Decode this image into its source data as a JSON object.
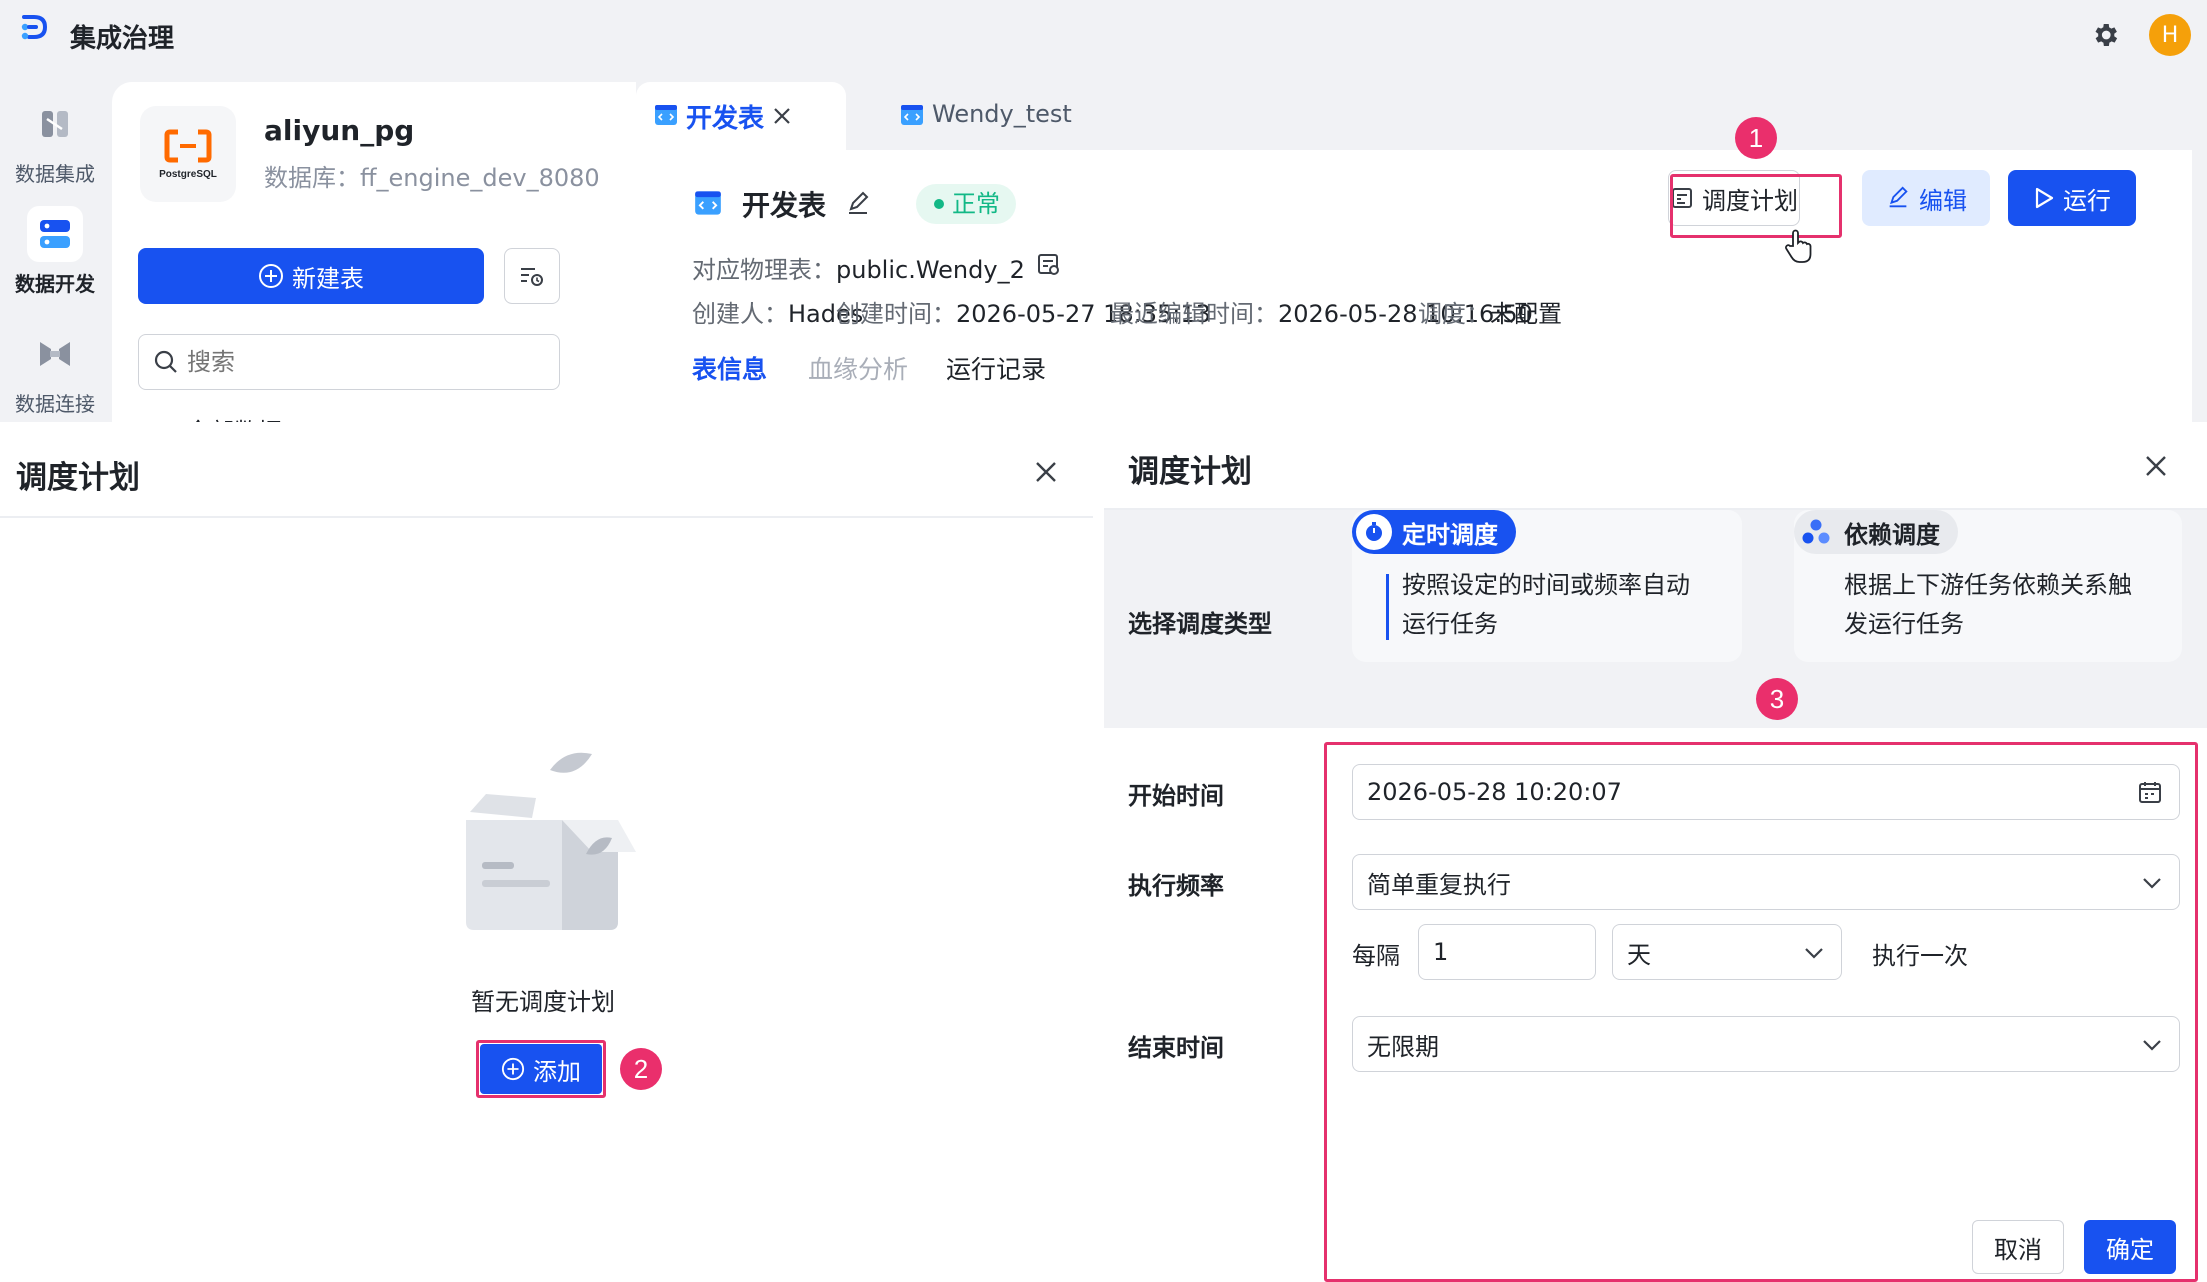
{
  "app": {
    "title": "集成治理",
    "avatar_letter": "H"
  },
  "rail": [
    {
      "label": "数据集成"
    },
    {
      "label": "数据开发"
    },
    {
      "label": "数据连接"
    }
  ],
  "datasource": {
    "name": "aliyun_pg",
    "logo_text": "PostgreSQL",
    "database": "数据库：ff_engine_dev_8080"
  },
  "panel": {
    "new_table": "新建表",
    "search_placeholder": "搜索",
    "tree_partial": "全部数据"
  },
  "tabs": [
    {
      "label": "开发表",
      "active": true
    },
    {
      "label": "Wendy_test",
      "active": false
    }
  ],
  "table": {
    "title": "开发表",
    "status": "正常",
    "physical_table_label": "对应物理表：",
    "physical_table": "public.Wendy_2",
    "creator_label": "创建人：",
    "creator": "Hades",
    "created_label": "创建时间：",
    "created": "2026-05-27 18:35:13",
    "edited_label": "最近编辑时间：",
    "edited": "2026-05-28 10:16:50",
    "schedule_label": "调度：",
    "schedule": "未配置"
  },
  "actions": {
    "schedule_plan": "调度计划",
    "edit": "编辑",
    "run": "运行"
  },
  "subtabs": [
    "表信息",
    "血缘分析",
    "运行记录"
  ],
  "steps": [
    "1",
    "2",
    "3"
  ],
  "dialog_left": {
    "title": "调度计划",
    "empty_text": "暂无调度计划",
    "add_button": "添加"
  },
  "dialog_right": {
    "title": "调度计划",
    "type_label": "选择调度类型",
    "types": [
      {
        "name": "定时调度",
        "desc1": "按照设定的时间或频率自动",
        "desc2": "运行任务",
        "selected": true
      },
      {
        "name": "依赖调度",
        "desc1": "根据上下游任务依赖关系触",
        "desc2": "发运行任务",
        "selected": false
      }
    ],
    "start_label": "开始时间",
    "start_value": "2026-05-28 10:20:07",
    "freq_label": "执行频率",
    "freq_value": "简单重复执行",
    "every_label": "每隔",
    "every_value": "1",
    "unit_value": "天",
    "every_suffix": "执行一次",
    "end_label": "结束时间",
    "end_value": "无限期",
    "cancel": "取消",
    "confirm": "确定"
  },
  "colors": {
    "primary": "#1852f0",
    "accent_red": "#e5316d",
    "status_green": "#12b886",
    "logo_orange": "#ff6a00",
    "avatar_orange": "#f5a00a"
  }
}
